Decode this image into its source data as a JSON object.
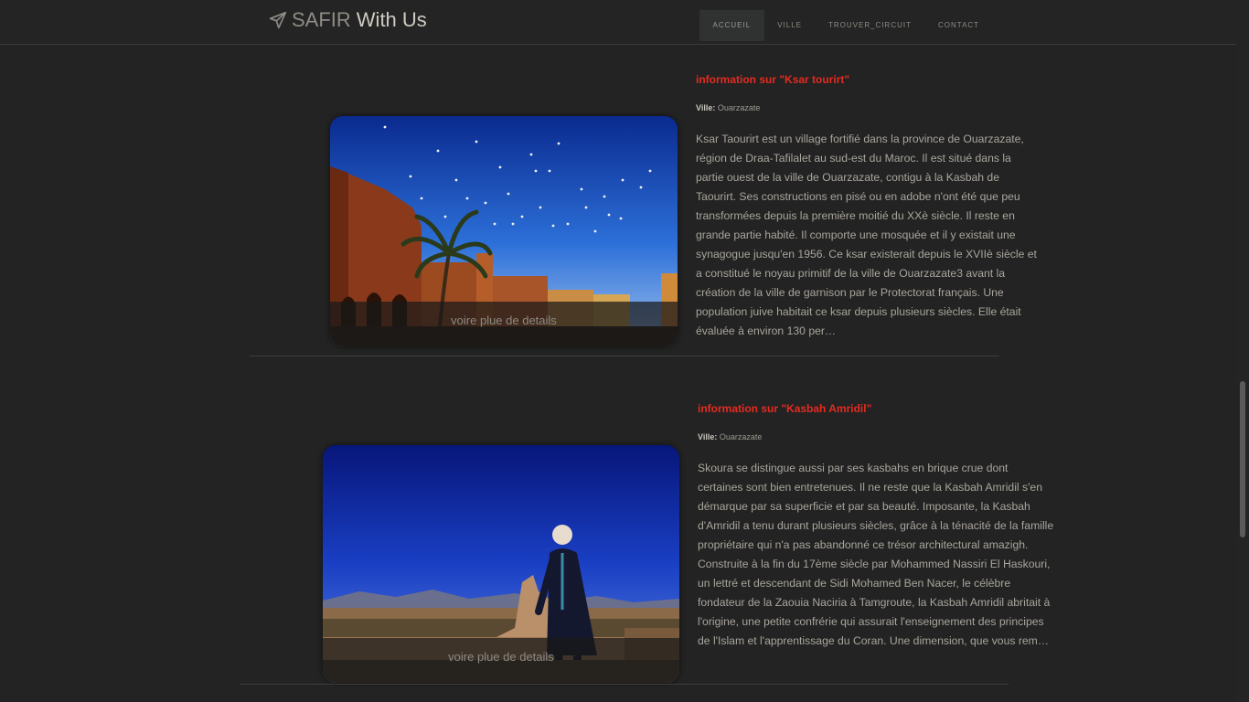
{
  "brand": {
    "part1": "SAFIR",
    "part2": "With Us",
    "icon": "paper-plane-icon"
  },
  "nav": {
    "items": [
      {
        "label": "ACCUEIL",
        "active": true
      },
      {
        "label": "VILLE",
        "active": false
      },
      {
        "label": "TROUVER_CIRCUIT",
        "active": false
      },
      {
        "label": "CONTACT",
        "active": false
      }
    ]
  },
  "places": [
    {
      "title": "information sur \"Ksar tourirt\"",
      "ville_label": "Ville:",
      "ville": "Ouarzazate",
      "description": "Ksar Taourirt est un village fortifié dans la province de Ouarzazate, région de Draa-Tafilalet au sud-est du Maroc. Il est situé dans la partie ouest de la ville de Ouarzazate, contigu à la Kasbah de Taourirt. Ses constructions en pisé ou en adobe n'ont été que peu transformées depuis la première moitié du XXè siècle. Il reste en grande partie habité. Il comporte une mosquée et il y existait une synagogue jusqu'en 1956. Ce ksar existerait depuis le XVIIè siècle et a constitué le noyau primitif de la ville de Ouarzazate3 avant la création de la ville de garnison par le Protectorat français. Une population juive habitait ce ksar depuis plusieurs siècles. Elle était évaluée à environ 130 per…",
      "details_label": "voire plue de details"
    },
    {
      "title": "information sur \"Kasbah Amridil\"",
      "ville_label": "Ville:",
      "ville": "Ouarzazate",
      "description": "Skoura se distingue aussi par ses kasbahs en brique crue dont certaines sont bien entretenues. Il ne reste que la Kasbah Amridil s'en démarque par sa superficie et par sa beauté. Imposante, la Kasbah d'Amridil a tenu durant plusieurs siècles, grâce à la ténacité de la famille propriétaire qui n'a pas abandonné ce trésor architectural amazigh. Construite à la fin du 17ème siècle par Mohammed Nassiri El Haskouri, un lettré et descendant de Sidi Mohamed Ben Nacer, le célèbre fondateur de la Zaouia Naciria à Tamgroute, la Kasbah Amridil abritait à l'origine, une petite confrérie qui assurait l'enseignement des principes de l'Islam et l'apprentissage du Coran. Une dimension, que vous rem…",
      "details_label": "voire plue de details"
    }
  ],
  "colors": {
    "background": "#222322",
    "title": "#e52b22",
    "text": "#aaa59e"
  }
}
